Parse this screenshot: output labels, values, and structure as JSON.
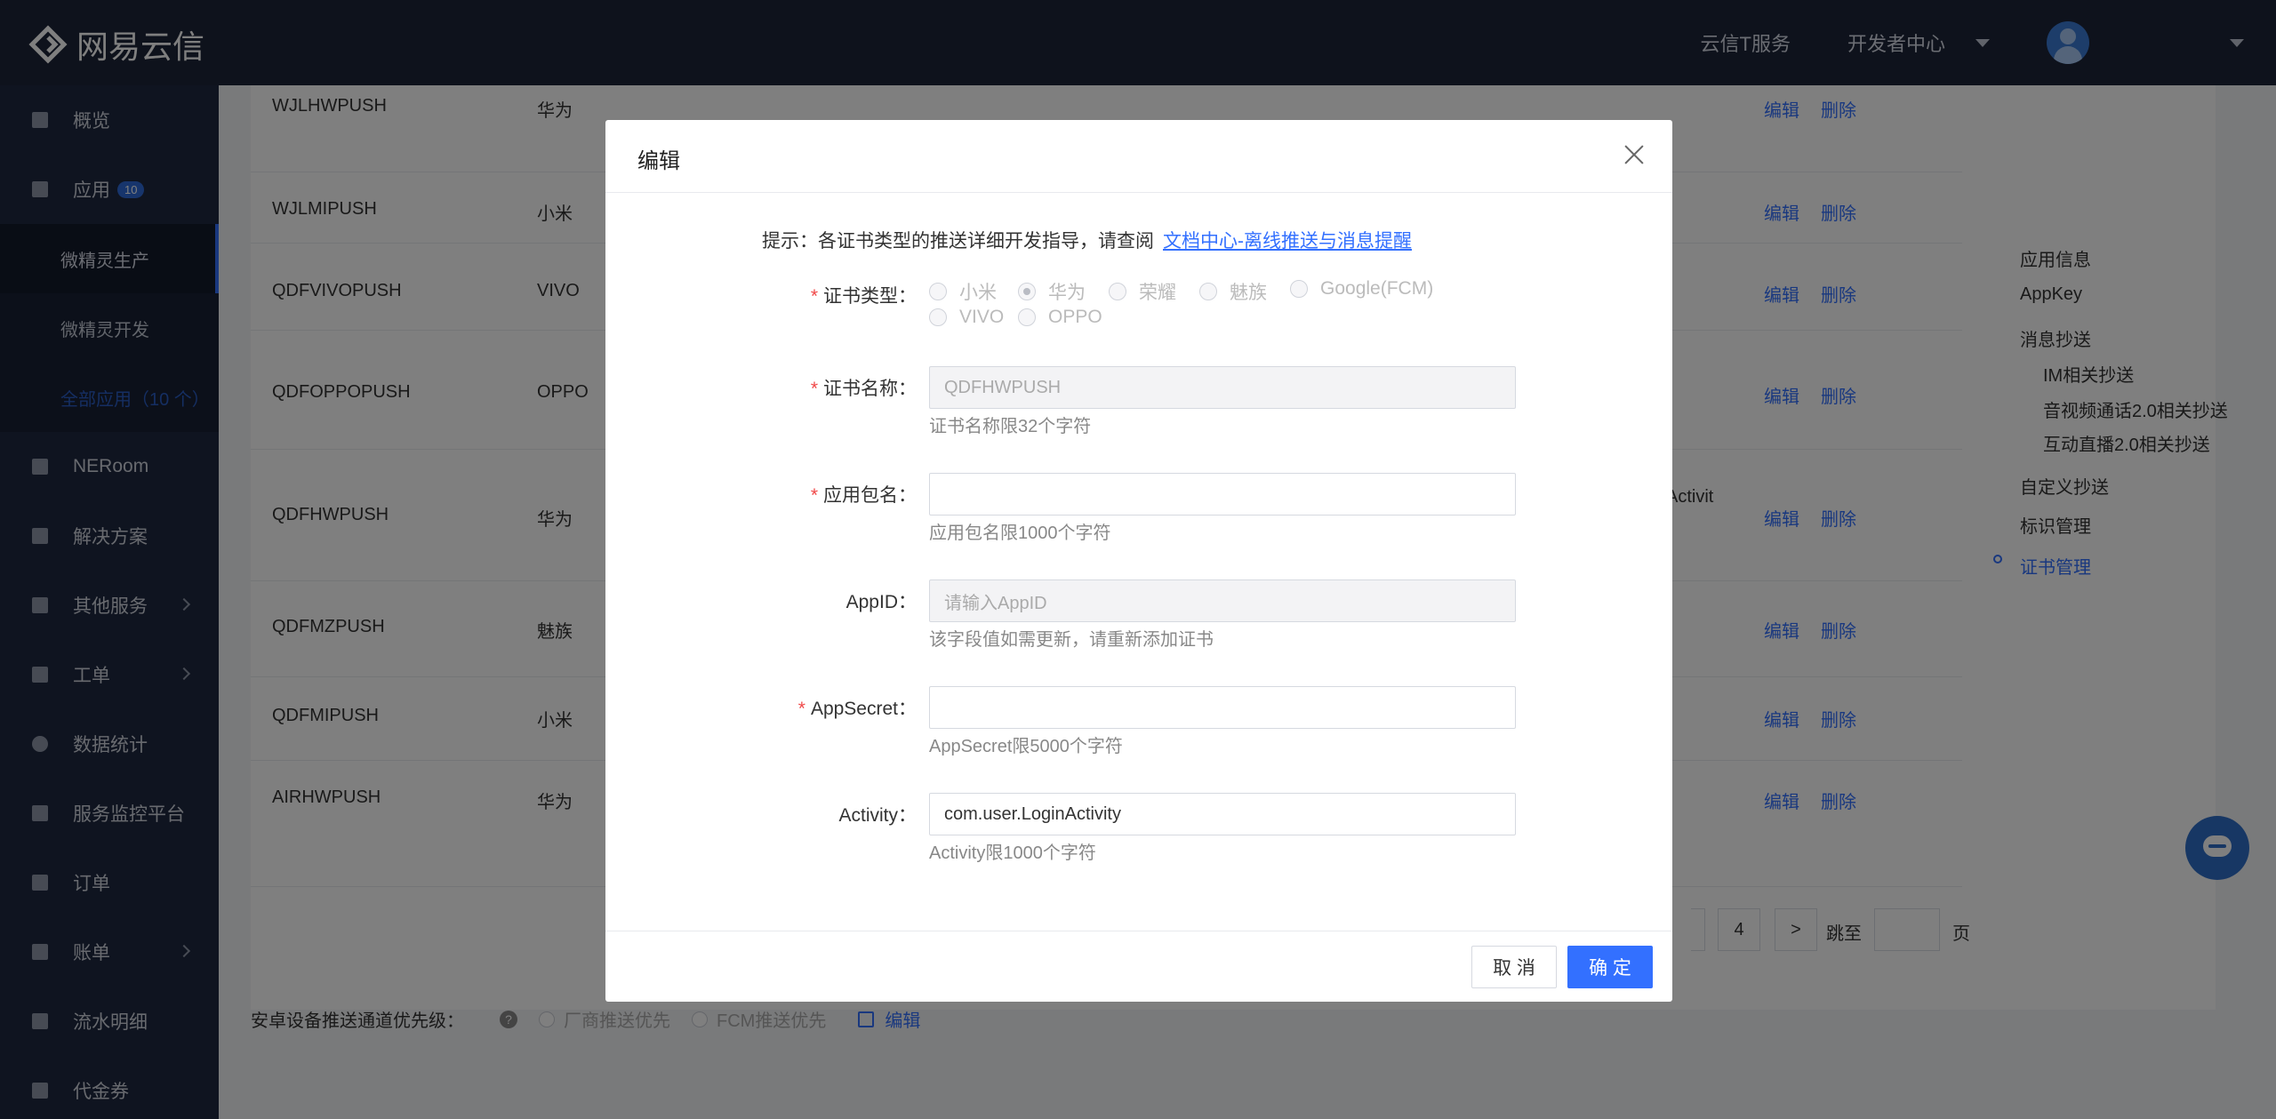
{
  "topbar": {
    "logo_text": "网易云信",
    "nav": [
      "云信T服务",
      "开发者中心"
    ]
  },
  "sidebar": {
    "overview": "概览",
    "apps": "应用",
    "apps_badge": "10",
    "sub_items": [
      "微精灵生产",
      "微精灵开发",
      "全部应用（10 个）"
    ],
    "items": [
      "NERoom",
      "解决方案",
      "其他服务",
      "工单",
      "数据统计",
      "服务监控平台",
      "订单",
      "账单",
      "流水明细",
      "代金券"
    ]
  },
  "table": {
    "rows": [
      {
        "name": "WJLHWPUSH",
        "vendor": "华为"
      },
      {
        "name": "WJLMIPUSH",
        "vendor": "小米"
      },
      {
        "name": "QDFVIVOPUSH",
        "vendor": "VIVO"
      },
      {
        "name": "QDFOPPOPUSH",
        "vendor": "OPPO"
      },
      {
        "name": "QDFHWPUSH",
        "vendor": "华为",
        "extra": "Activit"
      },
      {
        "name": "QDFMZPUSH",
        "vendor": "魅族"
      },
      {
        "name": "QDFMIPUSH",
        "vendor": "小米"
      },
      {
        "name": "AIRHWPUSH",
        "vendor": "华为"
      }
    ],
    "op_edit": "编辑",
    "op_delete": "删除"
  },
  "pager": {
    "page4": "4",
    "next": ">",
    "jump_label": "跳至",
    "page_suffix": "页"
  },
  "anchor_nav": {
    "items": [
      "应用信息",
      "AppKey",
      "消息抄送",
      "IM相关抄送",
      "音视频通话2.0相关抄送",
      "互动直播2.0相关抄送",
      "自定义抄送",
      "标识管理",
      "证书管理"
    ]
  },
  "bottom": {
    "label": "安卓设备推送通道优先级：",
    "q": "?",
    "opt1": "厂商推送优先",
    "opt2": "FCM推送优先",
    "edit": "编辑"
  },
  "modal": {
    "title": "编辑",
    "hint_prefix": "提示：各证书类型的推送详细开发指导，请查阅",
    "hint_link": "文档中心-离线推送与消息提醒",
    "cert_type_label": "证书类型：",
    "cert_types_row1": [
      "小米",
      "华为",
      "荣耀",
      "魅族",
      "Google(FCM)"
    ],
    "cert_types_row2": [
      "VIVO",
      "OPPO"
    ],
    "selected_type": "华为",
    "cert_name_label": "证书名称：",
    "cert_name_value": "QDFHWPUSH",
    "cert_name_help": "证书名称限32个字符",
    "package_label": "应用包名：",
    "package_value": "",
    "package_help": "应用包名限1000个字符",
    "appid_label": "AppID：",
    "appid_placeholder": "请输入AppID",
    "appid_help": "该字段值如需更新，请重新添加证书",
    "secret_label": "AppSecret：",
    "secret_value": "",
    "secret_help": "AppSecret限5000个字符",
    "activity_label": "Activity：",
    "activity_value": "com.user.LoginActivity",
    "activity_help": "Activity限1000个字符",
    "required_mark": "*",
    "cancel": "取 消",
    "ok": "确 定"
  }
}
